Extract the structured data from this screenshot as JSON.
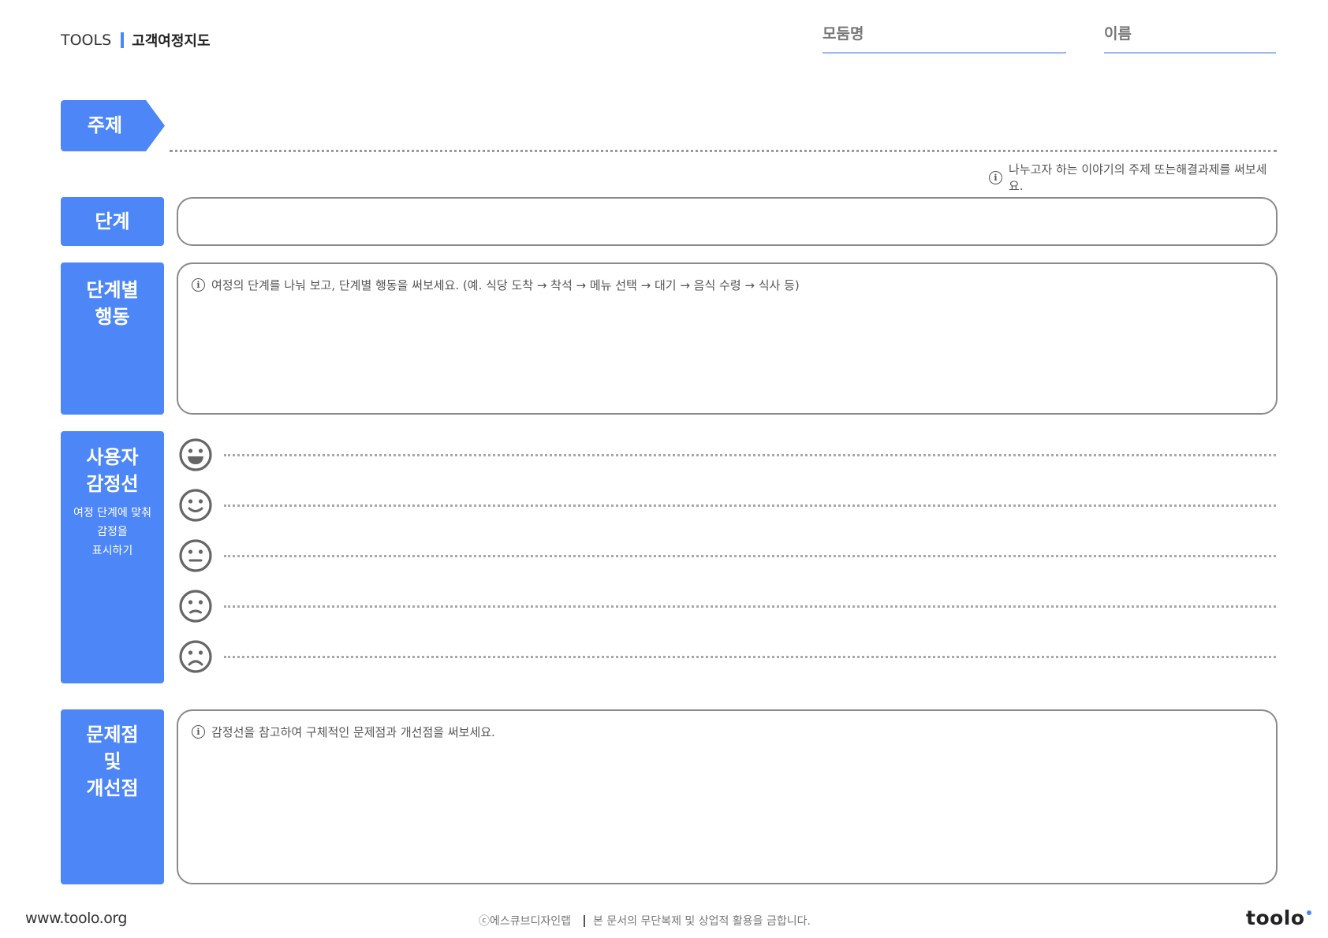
{
  "header": {
    "brand": "TOOLS",
    "title": "고객여정지도",
    "module_label": "모둠명",
    "name_label": "이름"
  },
  "topic": {
    "label": "주제",
    "hint": "나누고자 하는 이야기의 주제 또는해결과제를 써보세요."
  },
  "stage": {
    "label": "단계"
  },
  "actions": {
    "label_lines": [
      "단계별",
      "행동"
    ],
    "hint": "여정의 단계를 나눠 보고, 단계별 행동을 써보세요. (예.  식당 도착 → 착석 → 메뉴 선택 → 대기 →  음식 수령 → 식사 등)"
  },
  "emotion": {
    "label_lines": [
      "사용자",
      "감정선"
    ],
    "sub_lines": [
      "여정 단계에 맞춰",
      "감정을",
      "표시하기"
    ],
    "faces": [
      "very-happy-face-icon",
      "happy-face-icon",
      "neutral-face-icon",
      "unhappy-face-icon",
      "sad-face-icon"
    ]
  },
  "problems": {
    "label_lines": [
      "문제점",
      "및",
      "개선점"
    ],
    "hint": "감정선을 참고하여 구체적인 문제점과 개선점을 써보세요."
  },
  "footer": {
    "website": "www.toolo.org",
    "copyright_symbol": "ⓒ",
    "copyright": "에스큐브디자인랩",
    "notice": "본 문서의 무단복제 및 상업적 활용을 금합니다.",
    "logo": "toolo"
  },
  "colors": {
    "accent": "#4d86f7",
    "line": "#9db8f5",
    "border": "#8a8a8a"
  }
}
